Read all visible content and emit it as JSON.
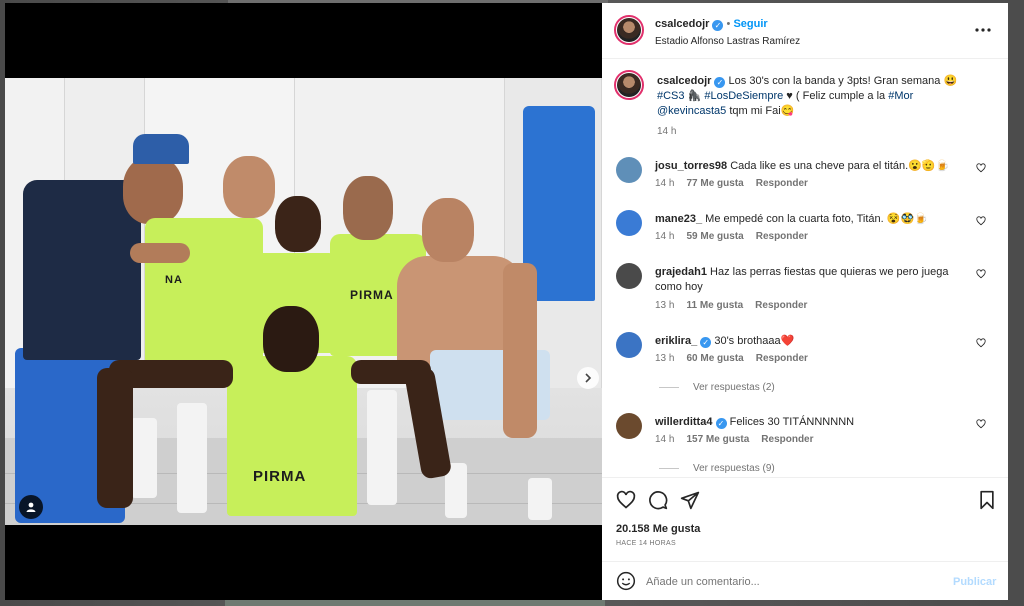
{
  "post": {
    "username": "csalcedojr",
    "follow_label": "Seguir",
    "separator": "•",
    "location": "Estadio Alfonso Lastras Ramírez",
    "more_icon": "more-horizontal-icon"
  },
  "caption": {
    "username": "csalcedojr",
    "line1": "Los 30's con la banda y 3pts! Gran semana 😃",
    "tag_cs3": "#CS3",
    "emoji_mid": "🦍",
    "tag_losdesiempre": "#LosDeSiempre",
    "line2_rest": "♥ ( Feliz cumple a la",
    "tag_mor": "#Mor",
    "mention": "@kevincasta5",
    "line3_rest": "tqm mi Fai😋",
    "time": "14 h"
  },
  "comments": [
    {
      "username": "josu_torres98",
      "text": "Cada like es una cheve para el titán.😮🫡🍺",
      "time": "14 h",
      "likes": "77 Me gusta",
      "reply": "Responder",
      "avatar_color": "#5f8fb8"
    },
    {
      "username": "mane23_",
      "text": "Me empedé con la cuarta foto, Titán. 😵🥸🍺",
      "time": "14 h",
      "likes": "59 Me gusta",
      "reply": "Responder",
      "avatar_color": "#3a7bd5"
    },
    {
      "username": "grajedah1",
      "text": "Haz las perras fiestas que quieras we pero juega como hoy",
      "time": "13 h",
      "likes": "11 Me gusta",
      "reply": "Responder",
      "avatar_color": "#4a4a4a"
    },
    {
      "username": "eriklira_",
      "text": "30's brothaaa❤️",
      "time": "13 h",
      "likes": "60 Me gusta",
      "reply": "Responder",
      "avatar_color": "#3b74c4",
      "verified": true,
      "view_replies": "Ver respuestas (2)"
    },
    {
      "username": "willerditta4",
      "text": "Felices 30 TITÁNNNNNN",
      "time": "14 h",
      "likes": "157 Me gusta",
      "reply": "Responder",
      "avatar_color": "#6b4a2e",
      "verified": true,
      "view_replies": "Ver respuestas (9)"
    }
  ],
  "actions": {
    "like_icon": "heart-icon",
    "comment_icon": "comment-icon",
    "share_icon": "send-icon",
    "save_icon": "bookmark-icon",
    "likes": "20.158 Me gusta",
    "posted": "HACE 14 HORAS"
  },
  "composer": {
    "emoji_icon": "emoji-icon",
    "placeholder": "Añade un comentario...",
    "publish_label": "Publicar"
  },
  "photo": {
    "vest_text": "PIRMA"
  }
}
